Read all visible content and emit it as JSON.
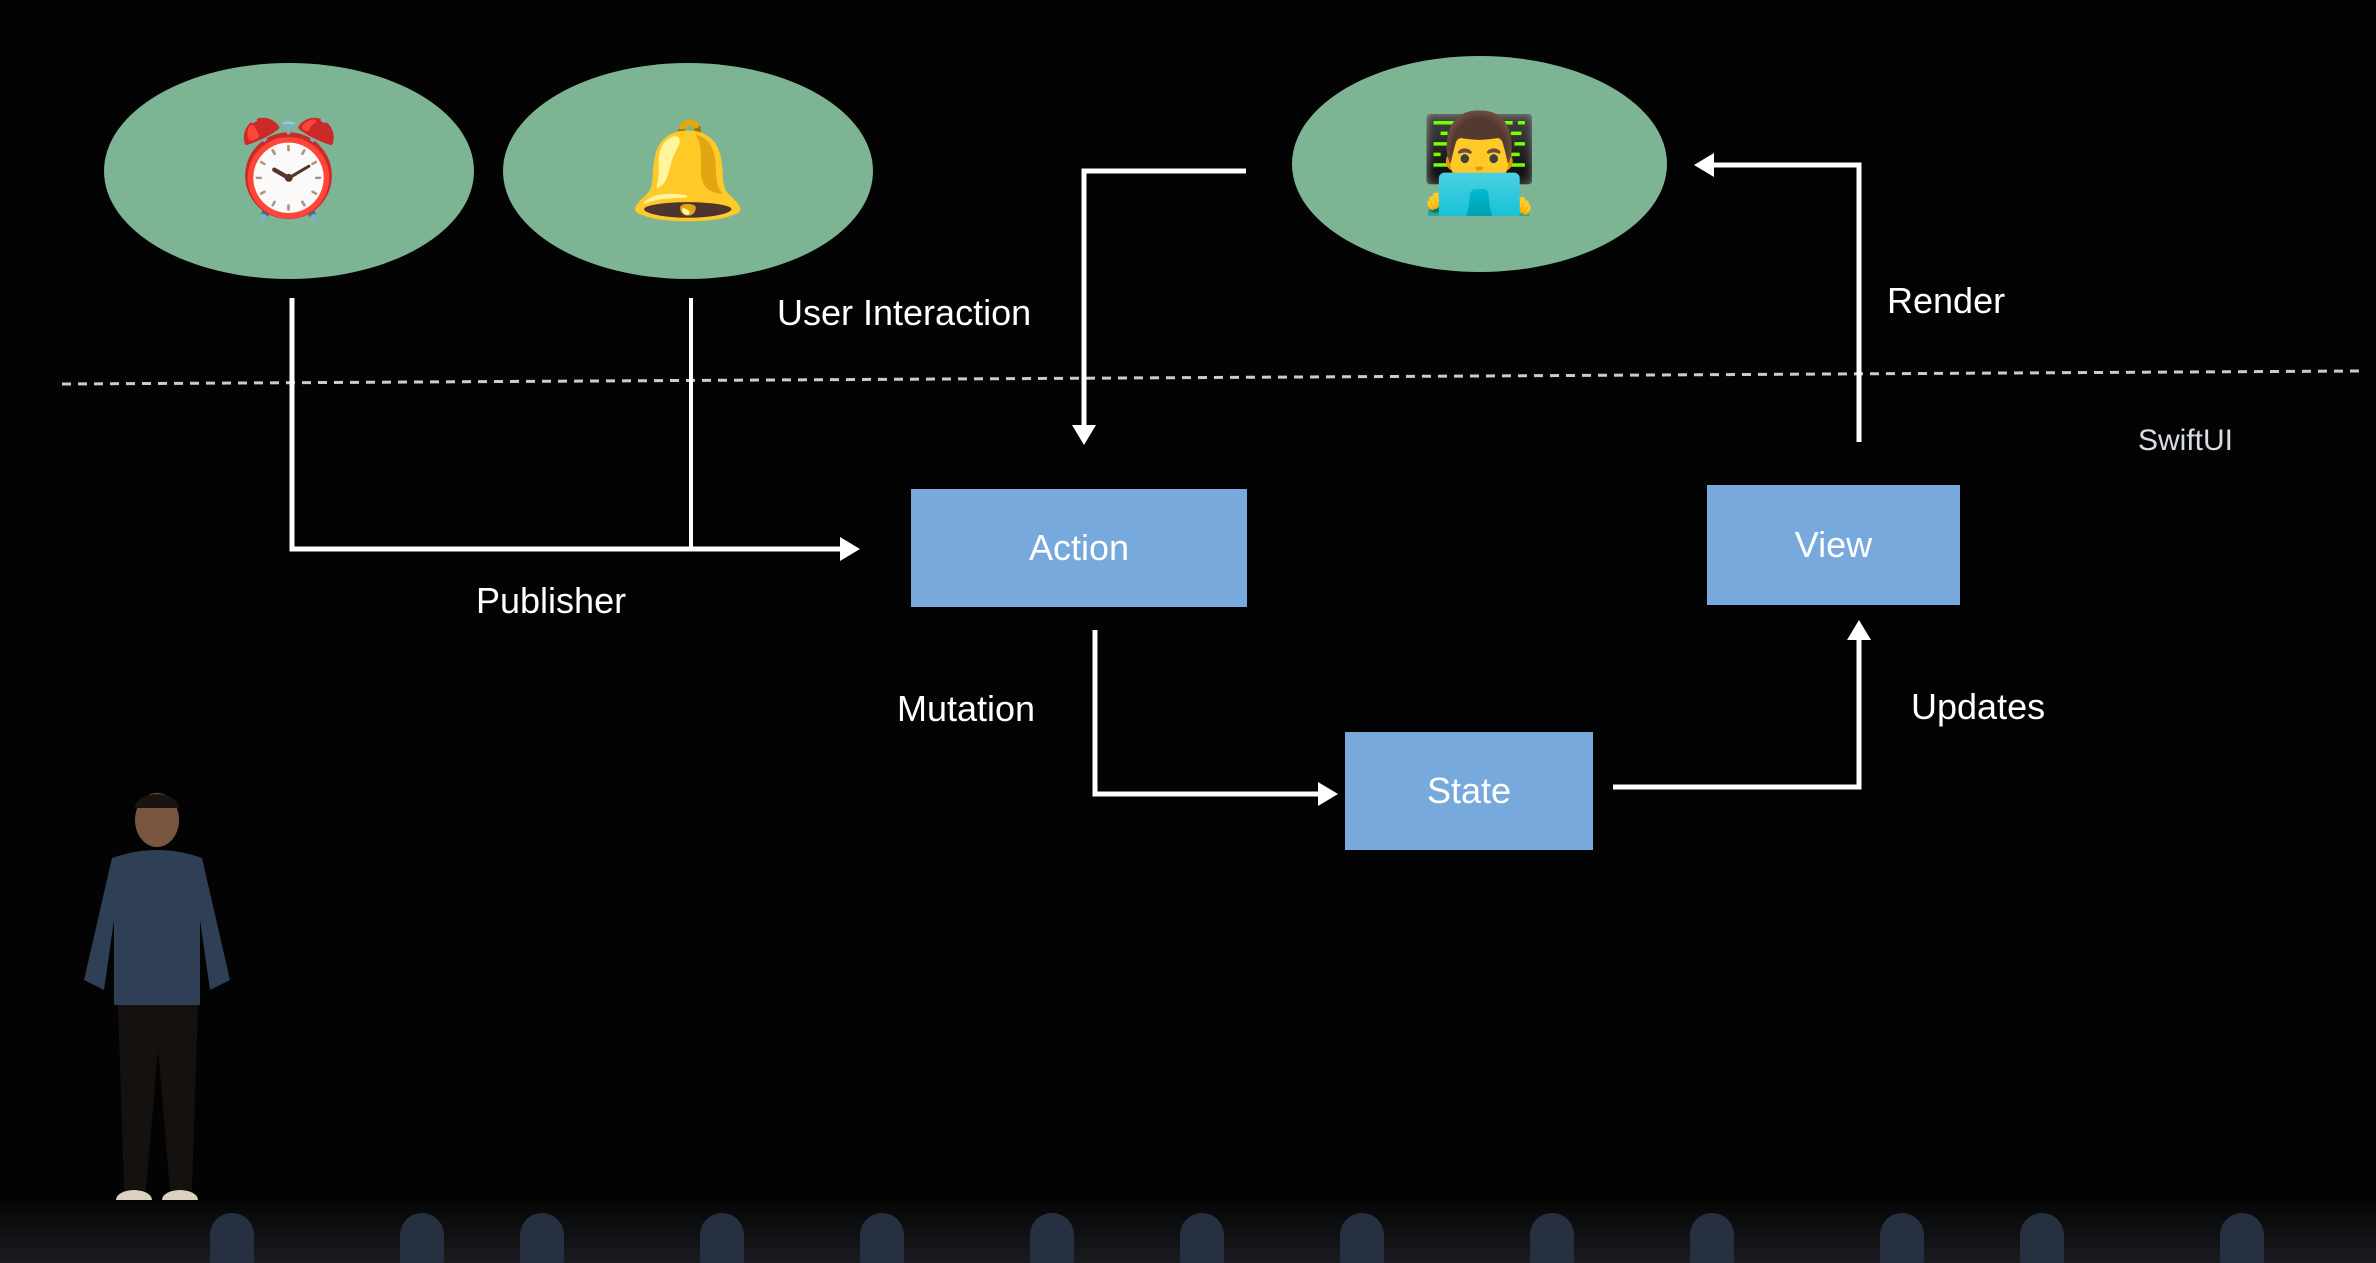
{
  "slide": {
    "framework_layer_label": "SwiftUI",
    "sources": [
      {
        "name": "timer",
        "icon": "alarm-clock-icon",
        "glyph": "⏰"
      },
      {
        "name": "notification",
        "icon": "bell-icon",
        "glyph": "🔔"
      },
      {
        "name": "user",
        "icon": "technologist-icon",
        "glyph": "👨‍💻"
      }
    ],
    "boxes": {
      "action": "Action",
      "state": "State",
      "view": "View"
    },
    "edge_labels": {
      "publisher": "Publisher",
      "user_interaction": "User Interaction",
      "mutation": "Mutation",
      "updates": "Updates",
      "render": "Render"
    },
    "colors": {
      "background": "#030303",
      "source_node": "#7db594",
      "box": "#77a9dc",
      "arrow": "#ffffff",
      "divider": "#c8ccd2"
    }
  }
}
